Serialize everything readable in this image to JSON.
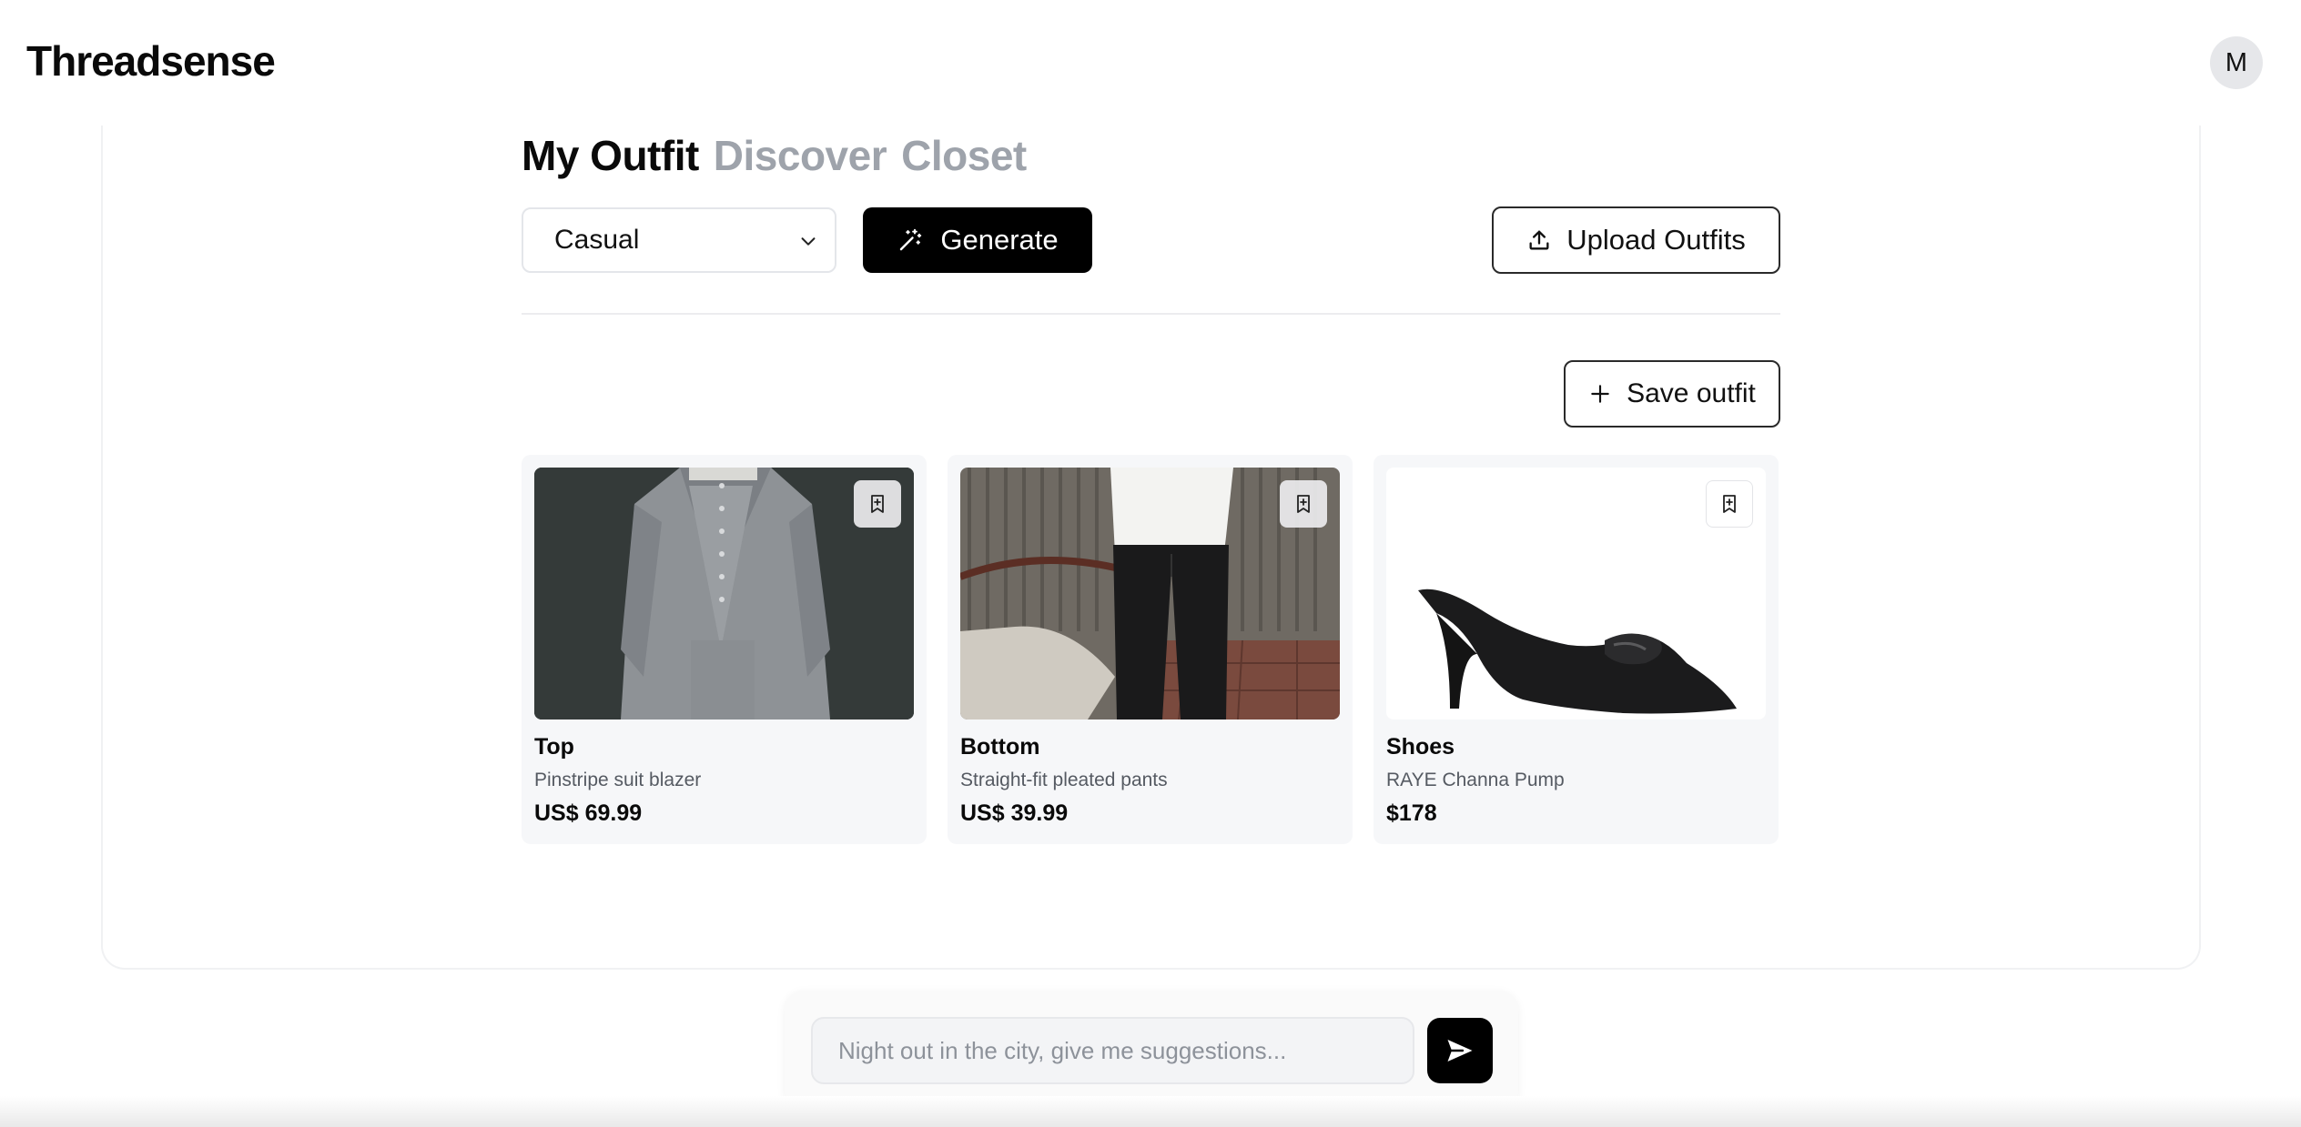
{
  "app": {
    "brand": "Threadsense",
    "avatar_initial": "M"
  },
  "tabs": [
    {
      "label": "My Outfit",
      "active": true
    },
    {
      "label": "Discover",
      "active": false
    },
    {
      "label": "Closet",
      "active": false
    }
  ],
  "controls": {
    "occasion_selected": "Casual",
    "generate_label": "Generate",
    "upload_label": "Upload Outfits",
    "save_label": "Save outfit"
  },
  "outfit": [
    {
      "category": "Top",
      "name": "Pinstripe suit blazer",
      "price": "US$ 69.99"
    },
    {
      "category": "Bottom",
      "name": "Straight-fit pleated pants",
      "price": "US$ 39.99"
    },
    {
      "category": "Shoes",
      "name": "RAYE Channa Pump",
      "price": "$178"
    }
  ],
  "chat": {
    "placeholder": "Night out in the city, give me suggestions..."
  },
  "icons": {
    "select_chevron": "chevron-down-icon",
    "generate": "magic-wand-icon",
    "upload": "upload-icon",
    "save": "plus-icon",
    "bookmark": "bookmark-plus-icon",
    "send": "send-icon"
  },
  "colors": {
    "accent": "#000000",
    "inactive_tab": "#9ea3ab",
    "card_bg": "#f6f7f9"
  }
}
